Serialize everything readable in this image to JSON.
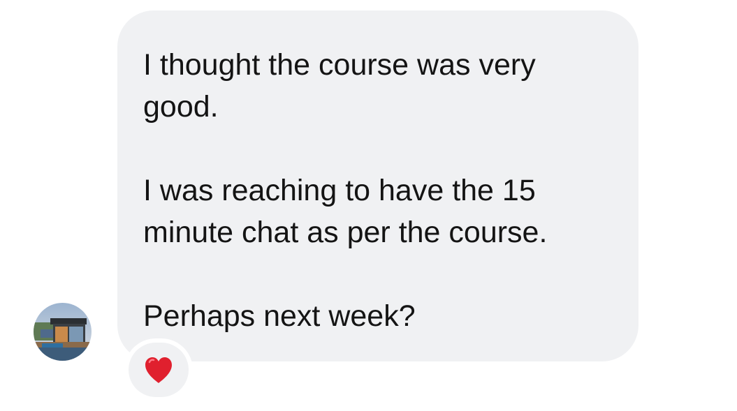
{
  "message": {
    "paragraphs": [
      "I thought the course was very\ngood.",
      " I was reaching to have the 15\nminute chat as per the course.",
      "Perhaps next week?"
    ],
    "bubble_color": "#f0f1f3",
    "text_color": "#141414"
  },
  "sender": {
    "avatar_icon": "avatar-house-photo"
  },
  "reaction": {
    "icon": "red-heart-icon",
    "color": "#e0202e"
  }
}
